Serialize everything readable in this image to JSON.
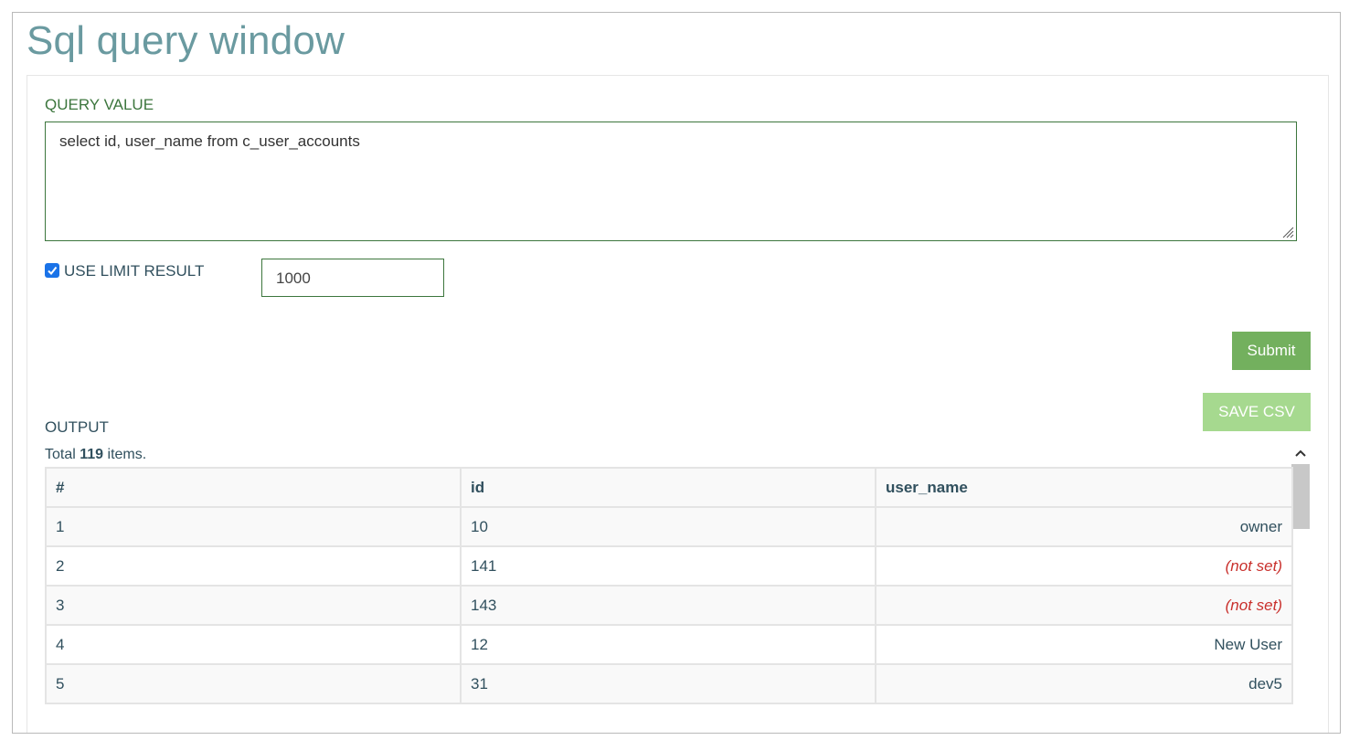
{
  "page": {
    "title": "Sql query window"
  },
  "query": {
    "label": "QUERY VALUE",
    "value": "select id, user_name from c_user_accounts"
  },
  "limit": {
    "checkbox_label": "USE LIMIT RESULT",
    "checked": true,
    "value": "1000"
  },
  "actions": {
    "submit_label": "Submit",
    "save_csv_label": "SAVE CSV"
  },
  "output": {
    "label": "OUTPUT",
    "total_prefix": "Total",
    "total_count": "119",
    "total_suffix": "items.",
    "columns": [
      "#",
      "id",
      "user_name"
    ],
    "rows": [
      {
        "num": "1",
        "id": "10",
        "user_name": "owner",
        "not_set": false
      },
      {
        "num": "2",
        "id": "141",
        "user_name": "(not set)",
        "not_set": true
      },
      {
        "num": "3",
        "id": "143",
        "user_name": "(not set)",
        "not_set": true
      },
      {
        "num": "4",
        "id": "12",
        "user_name": "New User",
        "not_set": false
      },
      {
        "num": "5",
        "id": "31",
        "user_name": "dev5",
        "not_set": false
      }
    ]
  },
  "colors": {
    "title": "#6a9aa0",
    "field_border": "#3c763d",
    "submit": "#73b05e",
    "save_csv": "#a6d98f",
    "not_set": "#c9302c",
    "checkbox": "#1a73e8"
  },
  "icons": [
    "check-icon",
    "resize-grip-icon",
    "chevron-up-icon"
  ]
}
